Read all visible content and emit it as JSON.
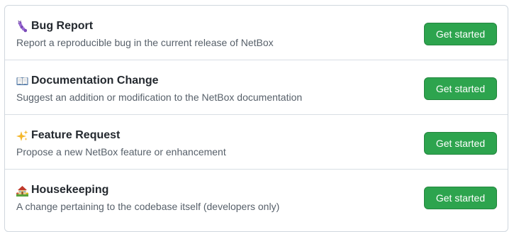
{
  "templates": [
    {
      "icon": "caterpillar-icon",
      "title": "Bug Report",
      "description": "Report a reproducible bug in the current release of NetBox",
      "button_label": "Get started"
    },
    {
      "icon": "open-book-icon",
      "title": "Documentation Change",
      "description": "Suggest an addition or modification to the NetBox documentation",
      "button_label": "Get started"
    },
    {
      "icon": "sparkles-icon",
      "title": "Feature Request",
      "description": "Propose a new NetBox feature or enhancement",
      "button_label": "Get started"
    },
    {
      "icon": "house-garden-icon",
      "title": "Housekeeping",
      "description": "A change pertaining to the codebase itself (developers only)",
      "button_label": "Get started"
    }
  ],
  "colors": {
    "button": "#2da44e",
    "border": "#d0d7de",
    "title_text": "#24292f",
    "description_text": "#57606a"
  }
}
